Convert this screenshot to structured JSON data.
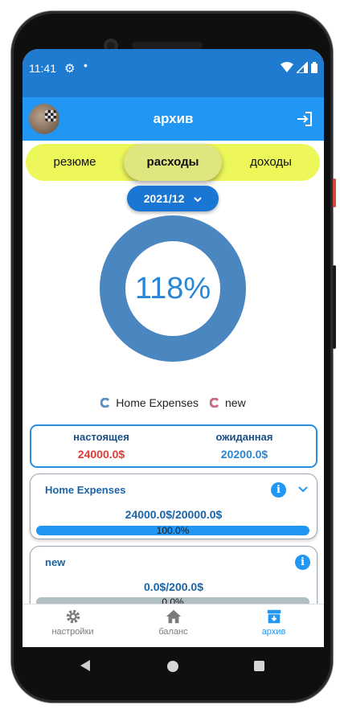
{
  "status_bar": {
    "time": "11:41",
    "gear": "⚙",
    "dot": "•"
  },
  "app_bar": {
    "title": "архив"
  },
  "tabs": [
    {
      "label": "резюме",
      "active": false
    },
    {
      "label": "расходы",
      "active": true
    },
    {
      "label": "доходы",
      "active": false
    }
  ],
  "period": {
    "label": "2021/12"
  },
  "chart_data": {
    "type": "pie",
    "center_label": "118%",
    "legend": [
      "Home Expenses",
      "new"
    ],
    "colors": {
      "ring": "#4a86c0",
      "label": "#2a86d6"
    }
  },
  "summary": {
    "actual_label": "настоящея",
    "actual_value": "24000.0$",
    "expected_label": "ожиданная",
    "expected_value": "20200.0$"
  },
  "categories": [
    {
      "title": "Home Expenses",
      "amount": "24000.0$/20000.0$",
      "percent_text": "100.0%",
      "fill": 1.0,
      "expanded_toggle": true
    },
    {
      "title": "new",
      "amount": "0.0$/200.0$",
      "percent_text": "0.0%",
      "fill": 0.0,
      "expanded_toggle": false
    }
  ],
  "bottom_nav": [
    {
      "label": "настройки",
      "icon": "gear-icon"
    },
    {
      "label": "баланс",
      "icon": "home-icon"
    },
    {
      "label": "архив",
      "icon": "archive-icon",
      "active": true
    }
  ],
  "colors": {
    "primary": "#2196f3",
    "status_bar": "#1e7bd0",
    "segment": "#eef75a",
    "danger": "#e53935"
  }
}
